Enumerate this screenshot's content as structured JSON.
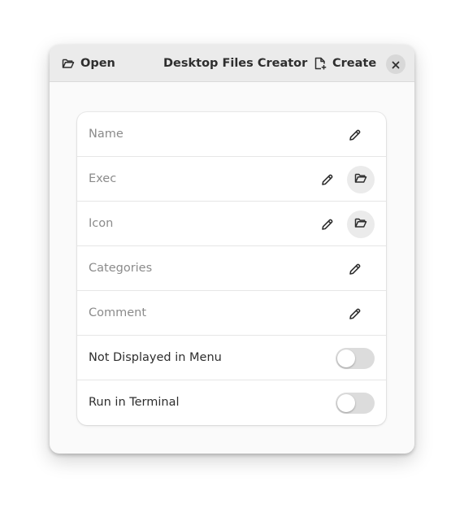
{
  "header": {
    "title": "Desktop Files Creator",
    "open_label": "Open",
    "create_label": "Create",
    "icons": {
      "open": "folder-open-icon",
      "create": "document-new-icon",
      "close": "close-icon"
    }
  },
  "rows": [
    {
      "label": "Name",
      "placeholder": true,
      "controls": [
        "edit-icon"
      ]
    },
    {
      "label": "Exec",
      "placeholder": true,
      "controls": [
        "edit-icon",
        "folder-open-icon"
      ]
    },
    {
      "label": "Icon",
      "placeholder": true,
      "controls": [
        "edit-icon",
        "folder-open-icon"
      ]
    },
    {
      "label": "Categories",
      "placeholder": true,
      "controls": [
        "edit-icon"
      ]
    },
    {
      "label": "Comment",
      "placeholder": true,
      "controls": [
        "edit-icon"
      ]
    },
    {
      "label": "Not Displayed in Menu",
      "placeholder": false,
      "switch_on": false
    },
    {
      "label": "Run in Terminal",
      "placeholder": false,
      "switch_on": false
    }
  ],
  "colors": {
    "headerbar": "#ebebeb",
    "window": "#fafafa",
    "list_bg": "#ffffff",
    "placeholder_text": "#8b8b8b",
    "text": "#2e2e2e",
    "switch_off": "#dcdcdc"
  }
}
